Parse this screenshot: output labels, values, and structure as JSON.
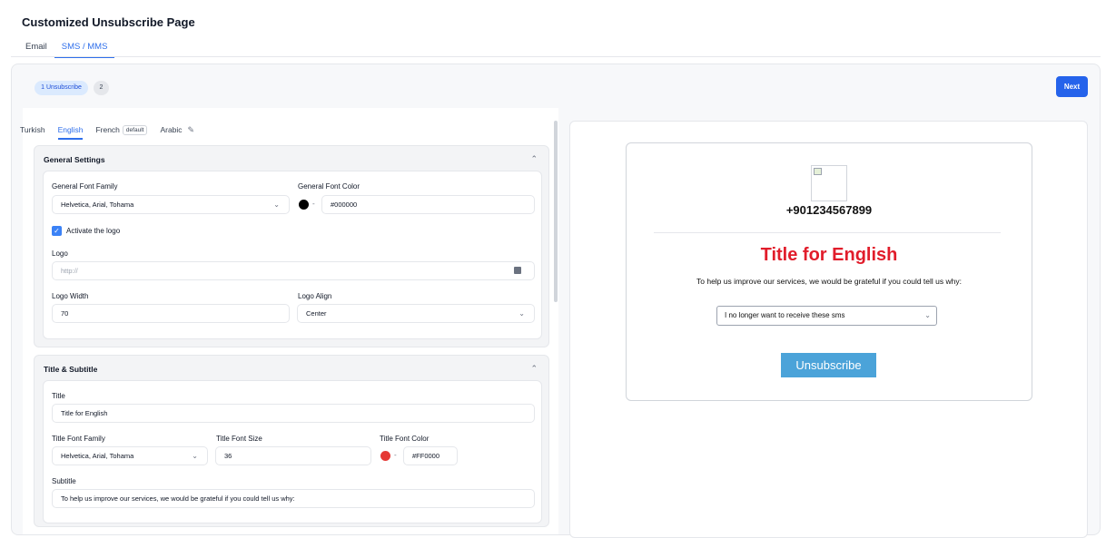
{
  "page": {
    "title": "Customized Unsubscribe Page"
  },
  "top_tabs": [
    {
      "label": "Email"
    },
    {
      "label": "SMS / MMS"
    }
  ],
  "stepper": {
    "step1": "1 Unsubscribe",
    "step2": "2",
    "next_label": "Next"
  },
  "lang_tabs": [
    {
      "label": "Turkish"
    },
    {
      "label": "English"
    },
    {
      "label": "French"
    },
    {
      "label": "Arabic"
    }
  ],
  "default_badge": "default",
  "general": {
    "heading": "General Settings",
    "font_family_label": "General Font Family",
    "font_family_value": "Helvetica, Arial, Tohama",
    "font_color_label": "General Font Color",
    "font_color_value": "#000000",
    "activate_logo_label": "Activate the logo",
    "logo_label": "Logo",
    "logo_placeholder": "http://",
    "logo_width_label": "Logo Width",
    "logo_width_value": "70",
    "logo_align_label": "Logo Align",
    "logo_align_value": "Center"
  },
  "title_section": {
    "heading": "Title & Subtitle",
    "title_label": "Title",
    "title_value": "Title for English",
    "title_font_family_label": "Title Font Family",
    "title_font_family_value": "Helvetica, Arial, Tohama",
    "title_font_size_label": "Title Font Size",
    "title_font_size_value": "36",
    "title_font_color_label": "Title Font Color",
    "title_font_color_value": "#FF0000",
    "subtitle_label": "Subtitle",
    "subtitle_value": "To help us improve our services, we would be grateful if you could tell us why:"
  },
  "preview": {
    "phone": "+901234567899",
    "title": "Title for English",
    "subtitle": "To help us improve our services, we would be grateful if you could tell us why:",
    "reason": "I no longer want to receive these sms",
    "button": "Unsubscribe"
  },
  "colors": {
    "accent": "#2563eb",
    "title_red": "#e11d2b",
    "button_blue": "#4ba3d9",
    "swatch_black": "#000000",
    "swatch_red": "#e53935"
  }
}
